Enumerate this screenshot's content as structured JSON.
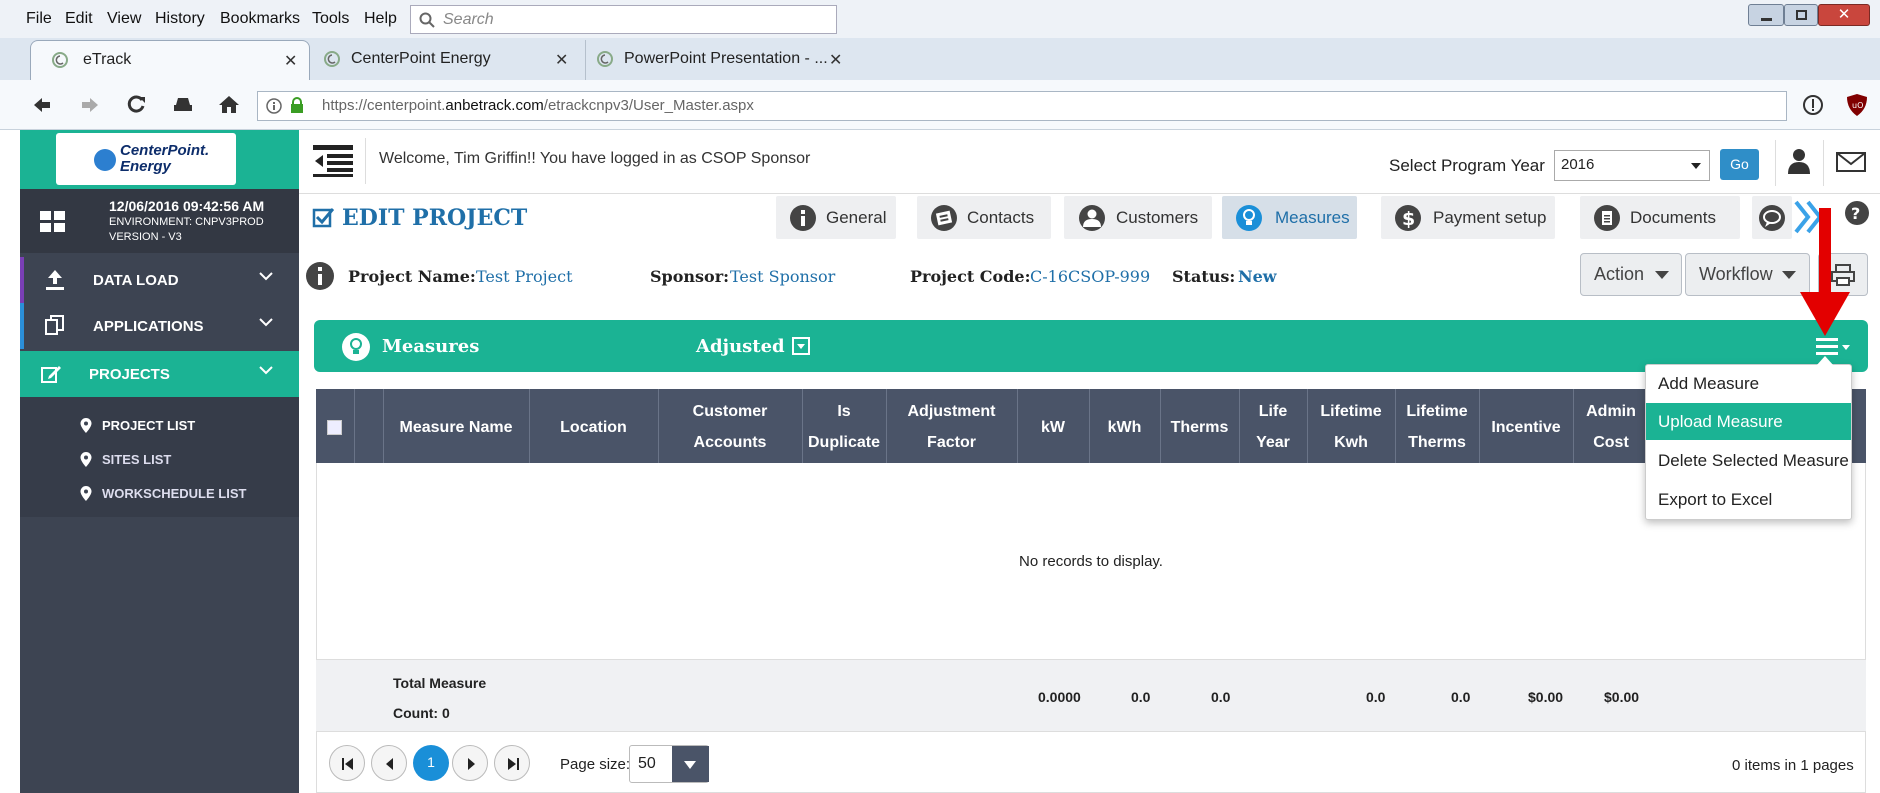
{
  "browser": {
    "menu": [
      "File",
      "Edit",
      "View",
      "History",
      "Bookmarks",
      "Tools",
      "Help"
    ],
    "search_placeholder": "Search",
    "tabs": [
      {
        "label": "eTrack"
      },
      {
        "label": "CenterPoint Energy"
      },
      {
        "label": "PowerPoint Presentation - ..."
      }
    ],
    "url_prefix": "https://centerpoint.",
    "url_domain": "anbetrack.com",
    "url_path": "/etrackcnpv3/User_Master.aspx"
  },
  "sidebar": {
    "logo_line1": "CenterPoint.",
    "logo_line2": "Energy",
    "datetime": "12/06/2016 09:42:56 AM",
    "environment": "ENVIRONMENT: CNPV3PROD",
    "version": "VERSION - V3",
    "nav": [
      {
        "label": "DATA LOAD"
      },
      {
        "label": "APPLICATIONS"
      },
      {
        "label": "PROJECTS"
      }
    ],
    "sub_items": [
      {
        "label": "PROJECT LIST"
      },
      {
        "label": "SITES LIST"
      },
      {
        "label": "WORKSCHEDULE LIST"
      }
    ]
  },
  "header": {
    "welcome": "Welcome, Tim Griffin!! You have logged in as CSOP Sponsor",
    "year_label": "Select Program Year",
    "year_value": "2016",
    "go_label": "Go"
  },
  "project": {
    "edit_title": "EDIT PROJECT",
    "tabs": [
      {
        "label": "General"
      },
      {
        "label": "Contacts"
      },
      {
        "label": "Customers"
      },
      {
        "label": "Measures"
      },
      {
        "label": "Payment setup"
      },
      {
        "label": "Documents"
      }
    ],
    "name_label": "Project Name:",
    "name_value": "Test Project",
    "sponsor_label": "Sponsor:",
    "sponsor_value": "Test Sponsor",
    "code_label": "Project Code:",
    "code_value": "C-16CSOP-999",
    "status_label": "Status:",
    "status_value": "New",
    "action_label": "Action",
    "workflow_label": "Workflow"
  },
  "measures": {
    "panel_title": "Measures",
    "adjusted_label": "Adjusted",
    "columns": [
      [
        "Measure Name"
      ],
      [
        "Location"
      ],
      [
        "Customer",
        "Accounts"
      ],
      [
        "Is",
        "Duplicate"
      ],
      [
        "Adjustment",
        "Factor"
      ],
      [
        "kW"
      ],
      [
        "kWh"
      ],
      [
        "Therms"
      ],
      [
        "Life",
        "Year"
      ],
      [
        "Lifetime",
        "Kwh"
      ],
      [
        "Lifetime",
        "Therms"
      ],
      [
        "Incentive"
      ],
      [
        "Admin",
        "Cost"
      ]
    ],
    "empty_text": "No records to display.",
    "total_label": "Total Measure",
    "count_label": "Count: 0",
    "totals": {
      "kw": "0.0000",
      "kwh": "0.0",
      "therms": "0.0",
      "lifetime_kwh": "0.0",
      "lifetime_therms": "0.0",
      "incentive": "$0.00",
      "admin_cost": "$0.00"
    },
    "page_number": "1",
    "page_size_label": "Page size:",
    "page_size": "50",
    "items_info": "0 items in 1 pages"
  },
  "dropdown_menu": {
    "items": [
      {
        "label": "Add Measure"
      },
      {
        "label": "Upload Measure"
      },
      {
        "label": "Delete Selected Measure"
      },
      {
        "label": "Export to Excel"
      }
    ],
    "selected_index": 1
  },
  "colors": {
    "accent_green": "#1bb394",
    "sidebar_dark": "#3d4452",
    "link_blue": "#1f6fa8",
    "arrow_red": "#e30000"
  }
}
